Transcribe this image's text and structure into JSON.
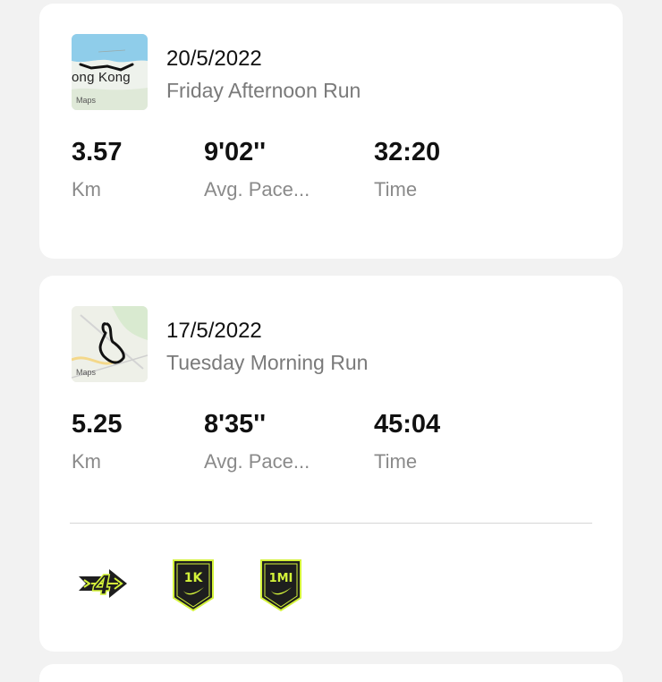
{
  "runs": [
    {
      "date": "20/5/2022",
      "name": "Friday Afternoon Run",
      "map": {
        "place_label": "ong Kong",
        "maps_label": "Maps",
        "icon": "map-thumbnail"
      },
      "stats": [
        {
          "value": "3.57",
          "label": "Km"
        },
        {
          "value": "9'02''",
          "label": "Avg. Pace..."
        },
        {
          "value": "32:20",
          "label": "Time"
        }
      ]
    },
    {
      "date": "17/5/2022",
      "name": "Tuesday Morning Run",
      "map": {
        "maps_label": "Maps",
        "icon": "map-thumbnail"
      },
      "stats": [
        {
          "value": "5.25",
          "label": "Km"
        },
        {
          "value": "8'35''",
          "label": "Avg. Pace..."
        },
        {
          "value": "45:04",
          "label": "Time"
        }
      ],
      "badges": [
        {
          "icon": "fourth-run-badge-icon",
          "text": "4"
        },
        {
          "icon": "1k-badge-icon",
          "text": "1K"
        },
        {
          "icon": "1mi-badge-icon",
          "text": "1MI"
        }
      ]
    }
  ],
  "colors": {
    "background": "#f2f2f2",
    "card": "#ffffff",
    "badge_fill": "#1e1e1e",
    "badge_accent": "#d4f33a",
    "secondary_text": "#7a7a7a"
  }
}
